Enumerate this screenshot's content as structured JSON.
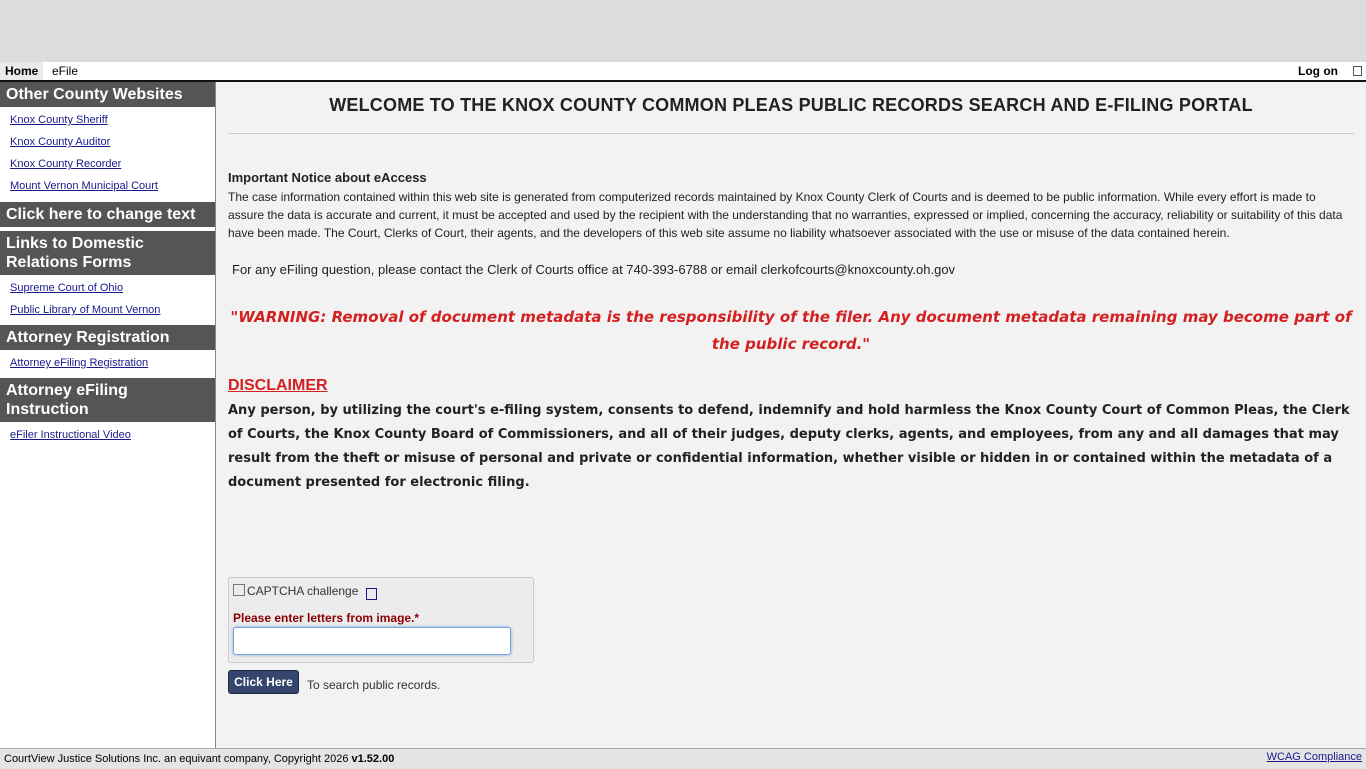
{
  "menubar": {
    "home": "Home",
    "efile": "eFile",
    "logon": "Log on"
  },
  "sidebar": {
    "sections": [
      {
        "heading": "Other County Websites",
        "links": [
          "Knox County Sheriff",
          "Knox County Auditor",
          "Knox County Recorder",
          "Mount Vernon Municipal Court"
        ]
      },
      {
        "heading": "Click here to change text",
        "links": []
      },
      {
        "heading": "Links to Domestic Relations Forms",
        "links": [
          "Supreme Court of Ohio",
          "Public Library of Mount Vernon"
        ]
      },
      {
        "heading": "Attorney Registration",
        "links": [
          "Attorney eFiling Registration"
        ]
      },
      {
        "heading": "Attorney eFiling Instruction",
        "links": [
          "eFiler Instructional Video"
        ]
      }
    ]
  },
  "main": {
    "title": "WELCOME TO THE KNOX COUNTY COMMON PLEAS PUBLIC RECORDS SEARCH AND E-FILING PORTAL",
    "notice_heading": "Important Notice about eAccess",
    "notice_body": "The case information contained within this web site is generated from computerized records maintained by Knox County Clerk of Courts and is deemed to be public information. While every effort is made to assure the data is accurate and current, it must be accepted and used by the recipient with the understanding that no warranties, expressed or implied, concerning the accuracy, reliability or suitability of this data have been made. The Court, Clerks of Court, their agents, and the developers of this web site assume no liability whatsoever associated with the use or misuse of the data contained herein.",
    "efile_question": "For any eFiling question, please contact the Clerk of Courts office at 740-393-6788 or email clerkofcourts@knoxcounty.oh.gov",
    "warning": "\"WARNING: Removal of document metadata is the responsibility of the filer.  Any document metadata remaining may become part of the public record.\"",
    "disclaimer_heading": "DISCLAIMER",
    "disclaimer_body": "Any person, by utilizing the court's e-filing system, consents to defend, indemnify and hold harmless the Knox County Court of Common Pleas, the Clerk of Courts, the Knox County Board of Commissioners, and all of their judges, deputy clerks, agents, and employees, from any and all damages that may result from the theft or misuse of personal and private or confidential information, whether visible or hidden in or contained within the metadata of a document presented for electronic filing."
  },
  "captcha": {
    "image_alt": "CAPTCHA challenge",
    "label": "Please enter letters from image.*",
    "value": ""
  },
  "search": {
    "button": "Click Here",
    "hint": "To search public records."
  },
  "footer": {
    "copyright": "CourtView Justice Solutions Inc. an equivant company, Copyright 2026 ",
    "version": "v1.52.00",
    "wcag": "WCAG Compliance"
  }
}
